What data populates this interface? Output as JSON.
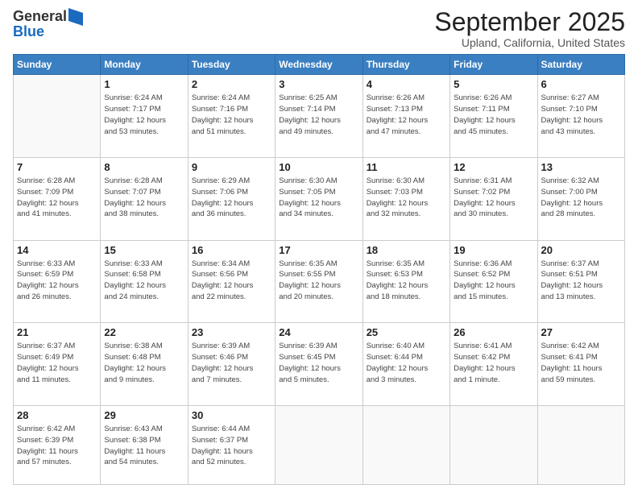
{
  "logo": {
    "general": "General",
    "blue": "Blue"
  },
  "header": {
    "title": "September 2025",
    "subtitle": "Upland, California, United States"
  },
  "days_of_week": [
    "Sunday",
    "Monday",
    "Tuesday",
    "Wednesday",
    "Thursday",
    "Friday",
    "Saturday"
  ],
  "weeks": [
    [
      {
        "day": "",
        "info": ""
      },
      {
        "day": "1",
        "info": "Sunrise: 6:24 AM\nSunset: 7:17 PM\nDaylight: 12 hours\nand 53 minutes."
      },
      {
        "day": "2",
        "info": "Sunrise: 6:24 AM\nSunset: 7:16 PM\nDaylight: 12 hours\nand 51 minutes."
      },
      {
        "day": "3",
        "info": "Sunrise: 6:25 AM\nSunset: 7:14 PM\nDaylight: 12 hours\nand 49 minutes."
      },
      {
        "day": "4",
        "info": "Sunrise: 6:26 AM\nSunset: 7:13 PM\nDaylight: 12 hours\nand 47 minutes."
      },
      {
        "day": "5",
        "info": "Sunrise: 6:26 AM\nSunset: 7:11 PM\nDaylight: 12 hours\nand 45 minutes."
      },
      {
        "day": "6",
        "info": "Sunrise: 6:27 AM\nSunset: 7:10 PM\nDaylight: 12 hours\nand 43 minutes."
      }
    ],
    [
      {
        "day": "7",
        "info": "Sunrise: 6:28 AM\nSunset: 7:09 PM\nDaylight: 12 hours\nand 41 minutes."
      },
      {
        "day": "8",
        "info": "Sunrise: 6:28 AM\nSunset: 7:07 PM\nDaylight: 12 hours\nand 38 minutes."
      },
      {
        "day": "9",
        "info": "Sunrise: 6:29 AM\nSunset: 7:06 PM\nDaylight: 12 hours\nand 36 minutes."
      },
      {
        "day": "10",
        "info": "Sunrise: 6:30 AM\nSunset: 7:05 PM\nDaylight: 12 hours\nand 34 minutes."
      },
      {
        "day": "11",
        "info": "Sunrise: 6:30 AM\nSunset: 7:03 PM\nDaylight: 12 hours\nand 32 minutes."
      },
      {
        "day": "12",
        "info": "Sunrise: 6:31 AM\nSunset: 7:02 PM\nDaylight: 12 hours\nand 30 minutes."
      },
      {
        "day": "13",
        "info": "Sunrise: 6:32 AM\nSunset: 7:00 PM\nDaylight: 12 hours\nand 28 minutes."
      }
    ],
    [
      {
        "day": "14",
        "info": "Sunrise: 6:33 AM\nSunset: 6:59 PM\nDaylight: 12 hours\nand 26 minutes."
      },
      {
        "day": "15",
        "info": "Sunrise: 6:33 AM\nSunset: 6:58 PM\nDaylight: 12 hours\nand 24 minutes."
      },
      {
        "day": "16",
        "info": "Sunrise: 6:34 AM\nSunset: 6:56 PM\nDaylight: 12 hours\nand 22 minutes."
      },
      {
        "day": "17",
        "info": "Sunrise: 6:35 AM\nSunset: 6:55 PM\nDaylight: 12 hours\nand 20 minutes."
      },
      {
        "day": "18",
        "info": "Sunrise: 6:35 AM\nSunset: 6:53 PM\nDaylight: 12 hours\nand 18 minutes."
      },
      {
        "day": "19",
        "info": "Sunrise: 6:36 AM\nSunset: 6:52 PM\nDaylight: 12 hours\nand 15 minutes."
      },
      {
        "day": "20",
        "info": "Sunrise: 6:37 AM\nSunset: 6:51 PM\nDaylight: 12 hours\nand 13 minutes."
      }
    ],
    [
      {
        "day": "21",
        "info": "Sunrise: 6:37 AM\nSunset: 6:49 PM\nDaylight: 12 hours\nand 11 minutes."
      },
      {
        "day": "22",
        "info": "Sunrise: 6:38 AM\nSunset: 6:48 PM\nDaylight: 12 hours\nand 9 minutes."
      },
      {
        "day": "23",
        "info": "Sunrise: 6:39 AM\nSunset: 6:46 PM\nDaylight: 12 hours\nand 7 minutes."
      },
      {
        "day": "24",
        "info": "Sunrise: 6:39 AM\nSunset: 6:45 PM\nDaylight: 12 hours\nand 5 minutes."
      },
      {
        "day": "25",
        "info": "Sunrise: 6:40 AM\nSunset: 6:44 PM\nDaylight: 12 hours\nand 3 minutes."
      },
      {
        "day": "26",
        "info": "Sunrise: 6:41 AM\nSunset: 6:42 PM\nDaylight: 12 hours\nand 1 minute."
      },
      {
        "day": "27",
        "info": "Sunrise: 6:42 AM\nSunset: 6:41 PM\nDaylight: 11 hours\nand 59 minutes."
      }
    ],
    [
      {
        "day": "28",
        "info": "Sunrise: 6:42 AM\nSunset: 6:39 PM\nDaylight: 11 hours\nand 57 minutes."
      },
      {
        "day": "29",
        "info": "Sunrise: 6:43 AM\nSunset: 6:38 PM\nDaylight: 11 hours\nand 54 minutes."
      },
      {
        "day": "30",
        "info": "Sunrise: 6:44 AM\nSunset: 6:37 PM\nDaylight: 11 hours\nand 52 minutes."
      },
      {
        "day": "",
        "info": ""
      },
      {
        "day": "",
        "info": ""
      },
      {
        "day": "",
        "info": ""
      },
      {
        "day": "",
        "info": ""
      }
    ]
  ]
}
